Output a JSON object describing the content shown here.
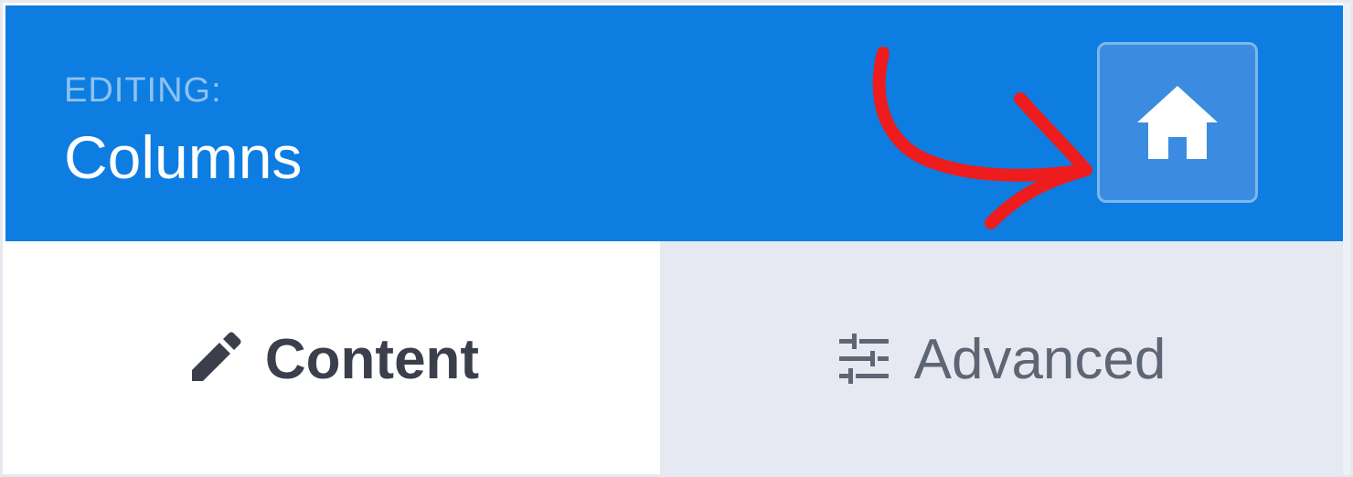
{
  "header": {
    "editing_label": "EDITING:",
    "title": "Columns",
    "home_button_icon": "home-icon",
    "background_color": "#0d7de1"
  },
  "annotation": {
    "type": "arrow",
    "color": "#ee1c1c",
    "points_to": "home-button"
  },
  "tabs": [
    {
      "label": "Content",
      "icon": "pencil-icon",
      "active": true
    },
    {
      "label": "Advanced",
      "icon": "sliders-icon",
      "active": false
    }
  ]
}
